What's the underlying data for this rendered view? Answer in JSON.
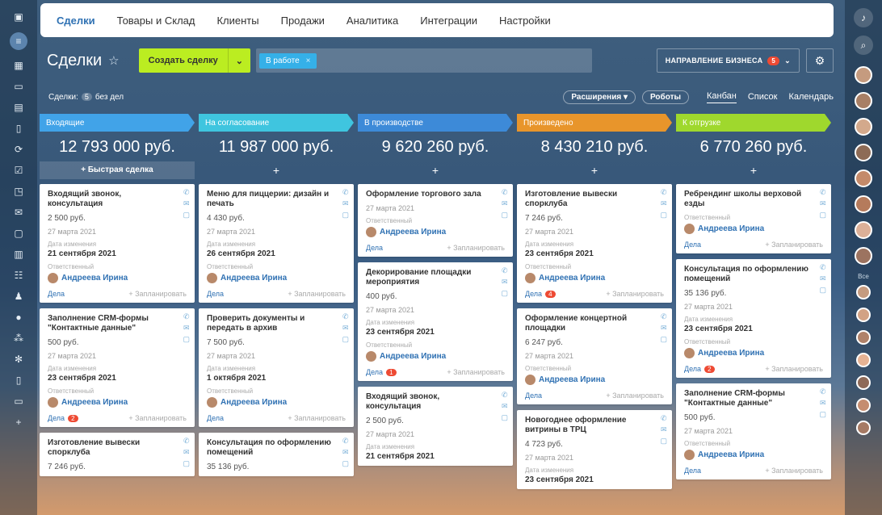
{
  "nav": {
    "tabs": [
      "Сделки",
      "Товары и Склад",
      "Клиенты",
      "Продажи",
      "Аналитика",
      "Интеграции",
      "Настройки"
    ]
  },
  "toolbar": {
    "title": "Сделки",
    "create_label": "Создать сделку",
    "filter_chip": "В работе",
    "direction_label": "НАПРАВЛЕНИЕ БИЗНЕСА",
    "direction_badge": "5"
  },
  "subbar": {
    "deals_label": "Сделки:",
    "deals_count": "5",
    "deals_suffix": "без дел",
    "extensions": "Расширения",
    "robots": "Роботы",
    "views": [
      "Канбан",
      "Список",
      "Календарь"
    ]
  },
  "right_rail": {
    "label": "Все"
  },
  "quick_deal": "+ Быстрая сделка",
  "labels": {
    "changed": "Дата изменения",
    "responsible": "Ответственный",
    "deals": "Дела",
    "plan": "+ Запланировать"
  },
  "colors": {
    "stage1": "#41a3e8",
    "stage2": "#3fc5df",
    "stage3": "#3d8ad8",
    "stage4": "#e8952b",
    "stage5": "#9fd82d",
    "accent_green": "#bbed21",
    "badge_red": "#ee4a33"
  },
  "columns": [
    {
      "name": "Входящие",
      "sum": "12 793 000 руб.",
      "cards": [
        {
          "title": "Входящий звонок, консультация",
          "price": "2 500 руб.",
          "date": "27 марта 2021",
          "changed": "21 сентября 2021",
          "person": "Андреева Ирина",
          "badge": ""
        },
        {
          "title": "Заполнение CRM-формы \"Контактные данные\"",
          "price": "500 руб.",
          "date": "27 марта 2021",
          "changed": "23 сентября 2021",
          "person": "Андреева Ирина",
          "badge": "2"
        },
        {
          "title": "Изготовление вывески спорклуба",
          "price": "7 246 руб.",
          "date": "",
          "changed": "",
          "person": "",
          "badge": ""
        }
      ]
    },
    {
      "name": "На согласование",
      "sum": "11 987 000 руб.",
      "cards": [
        {
          "title": "Меню для пиццерии: дизайн и печать",
          "price": "4 430 руб.",
          "date": "27 марта 2021",
          "changed": "26 сентября 2021",
          "person": "Андреева Ирина",
          "badge": ""
        },
        {
          "title": "Проверить документы и передать в архив",
          "price": "7 500 руб.",
          "date": "27 марта 2021",
          "changed": "1 октября 2021",
          "person": "Андреева Ирина",
          "badge": ""
        },
        {
          "title": "Консультация по оформлению помещений",
          "price": "35 136 руб.",
          "date": "",
          "changed": "",
          "person": "",
          "badge": ""
        }
      ]
    },
    {
      "name": "В производстве",
      "sum": "9 620 260 руб.",
      "cards": [
        {
          "title": "Оформление торгового зала",
          "price": "",
          "date": "27 марта 2021",
          "changed": "",
          "person": "Андреева Ирина",
          "badge": ""
        },
        {
          "title": "Декорирование площадки мероприятия",
          "price": "400 руб.",
          "date": "27 марта 2021",
          "changed": "23 сентября 2021",
          "person": "Андреева Ирина",
          "badge": "1"
        },
        {
          "title": "Входящий звонок, консультация",
          "price": "2 500 руб.",
          "date": "27 марта 2021",
          "changed": "21 сентября 2021",
          "person": "",
          "badge": ""
        }
      ]
    },
    {
      "name": "Произведено",
      "sum": "8 430 210 руб.",
      "cards": [
        {
          "title": "Изготовление вывески спорклуба",
          "price": "7 246 руб.",
          "date": "27 марта 2021",
          "changed": "23 сентября 2021",
          "person": "Андреева Ирина",
          "badge": "4"
        },
        {
          "title": "Оформление концертной площадки",
          "price": "6 247 руб.",
          "date": "27 марта 2021",
          "changed": "",
          "person": "Андреева Ирина",
          "badge": ""
        },
        {
          "title": "Новогоднее оформление витрины в ТРЦ",
          "price": "4 723 руб.",
          "date": "27 марта 2021",
          "changed": "23 сентября 2021",
          "person": "",
          "badge": ""
        }
      ]
    },
    {
      "name": "К отгрузке",
      "sum": "6 770 260 руб.",
      "cards": [
        {
          "title": "Ребрендинг школы верховой езды",
          "price": "",
          "date": "",
          "changed": "",
          "person": "Андреева Ирина",
          "badge": ""
        },
        {
          "title": "Консультация по оформлению помещений",
          "price": "35 136 руб.",
          "date": "27 марта 2021",
          "changed": "23 сентября 2021",
          "person": "Андреева Ирина",
          "badge": "2"
        },
        {
          "title": "Заполнение CRM-формы \"Контактные данные\"",
          "price": "500 руб.",
          "date": "27 марта 2021",
          "changed": "",
          "person": "Андреева Ирина",
          "badge": ""
        }
      ]
    }
  ]
}
